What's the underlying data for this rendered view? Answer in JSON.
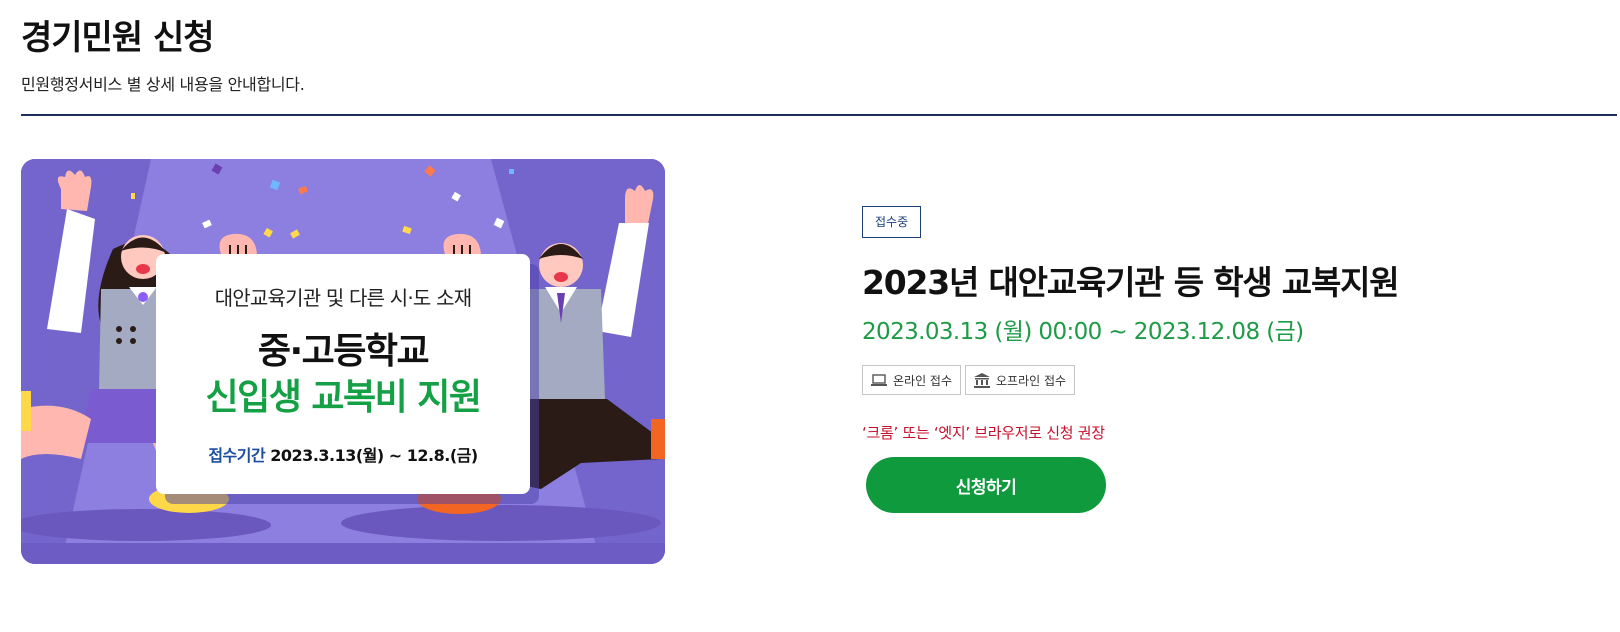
{
  "header": {
    "title": "경기민원 신청",
    "description": "민원행정서비스 별 상세 내용을 안내합니다."
  },
  "banner": {
    "line1": "대안교육기관 및 다른 시·도 소재",
    "line2": "중·고등학교",
    "line3": "신입생 교복비 지원",
    "period_label": "접수기간",
    "period_value": "2023.3.13(월) ~ 12.8.(금)"
  },
  "service": {
    "status": "접수중",
    "title": "2023년 대안교육기관 등 학생 교복지원",
    "period": "2023.03.13 (월) 00:00 ~ 2023.12.08 (금)",
    "methods": [
      {
        "icon": "laptop-icon",
        "label": "온라인 접수"
      },
      {
        "icon": "building-icon",
        "label": "오프라인 접수"
      }
    ],
    "notice": "‘크롬’ 또는 ‘엣지’ 브라우저로 신청 권장",
    "apply_label": "신청하기"
  },
  "colors": {
    "accent_green": "#0f9a3d",
    "period_green": "#1e9b46",
    "notice_red": "#c8102e",
    "rule_navy": "#1c2f57",
    "banner_purple": "#7f70d6"
  }
}
